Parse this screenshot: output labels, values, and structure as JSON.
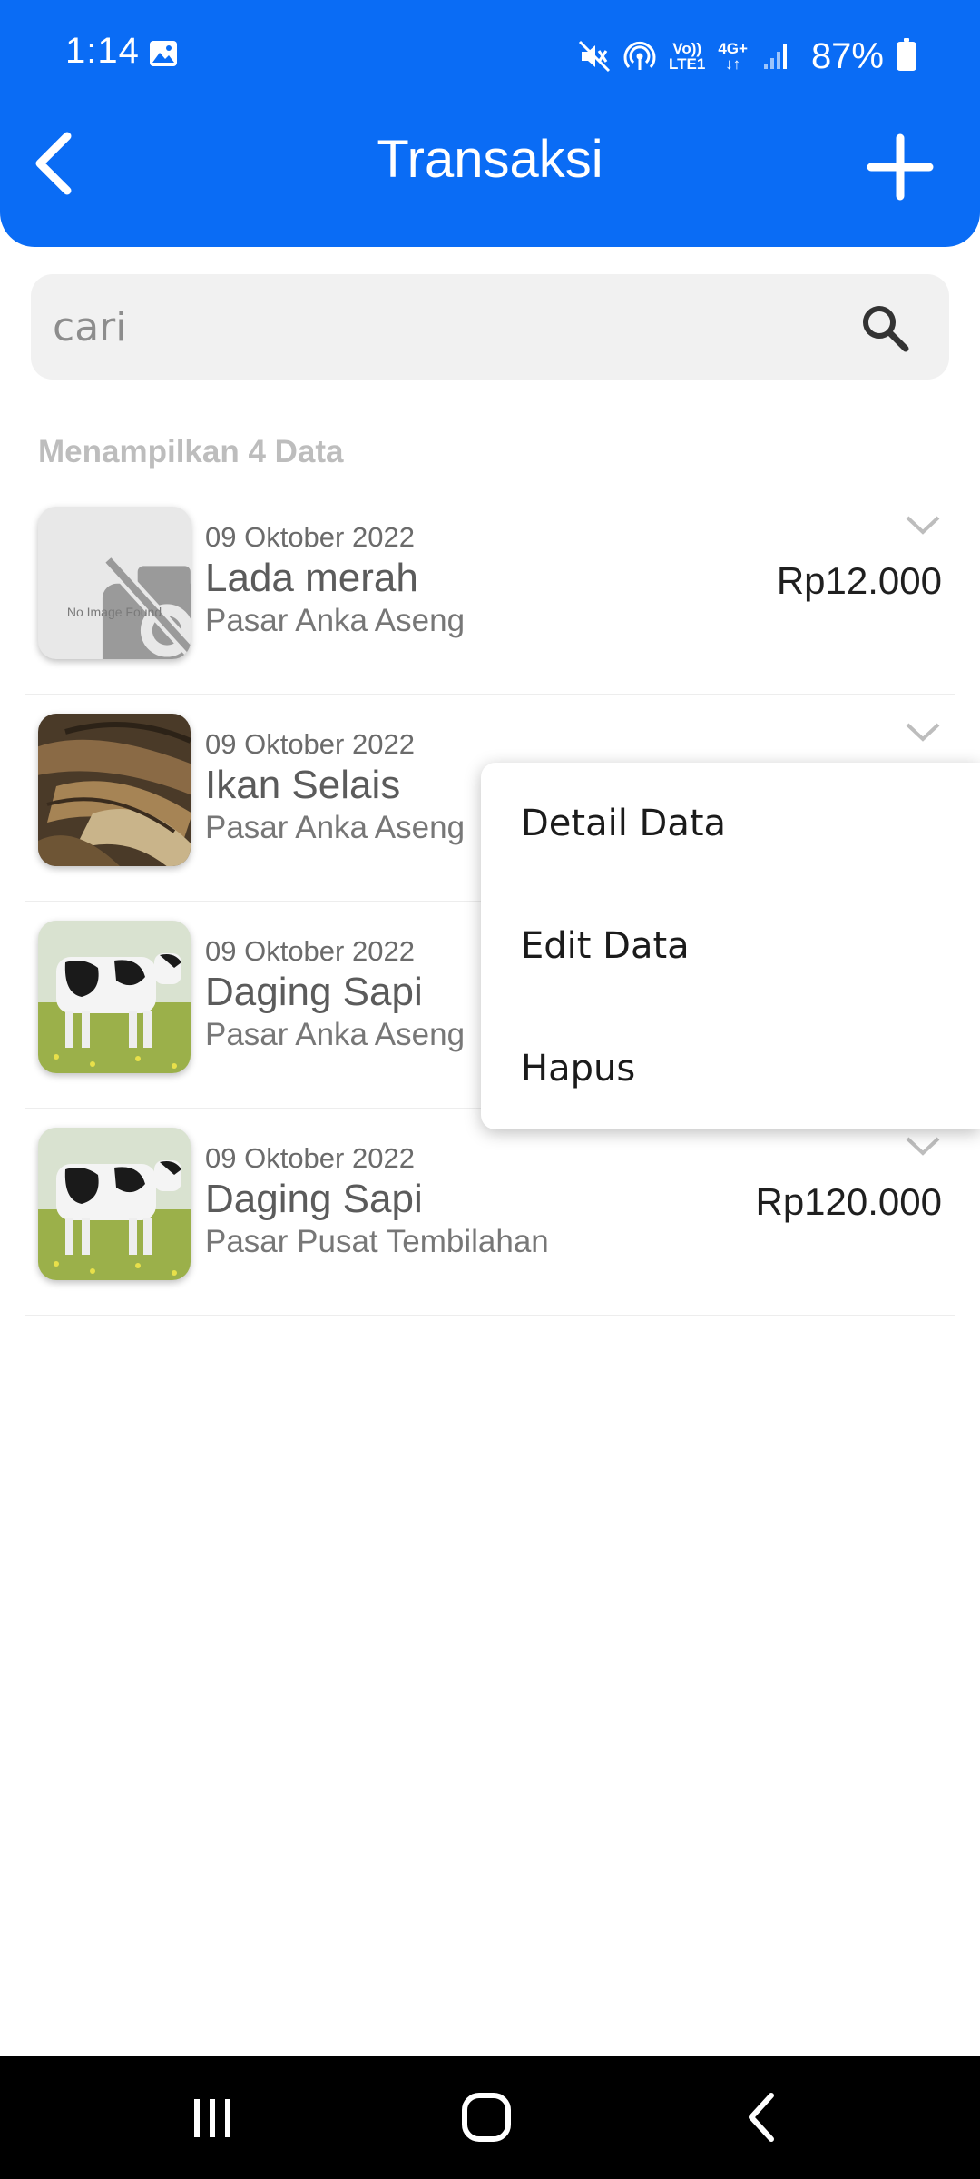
{
  "status_bar": {
    "time": "1:14",
    "volte_top": "Vo))",
    "volte_bottom": "LTE1",
    "network": "4G+",
    "battery": "87%"
  },
  "header": {
    "title": "Transaksi",
    "background_color": "#0a6cf5"
  },
  "search": {
    "placeholder": "cari"
  },
  "list": {
    "count_label": "Menampilkan 4 Data",
    "items": [
      {
        "date": "09 Oktober 2022",
        "name": "Lada merah",
        "place": "Pasar Anka Aseng",
        "price": "Rp12.000",
        "image": "no-image",
        "no_image_text": "No Image Found"
      },
      {
        "date": "09 Oktober 2022",
        "name": "Ikan Selais",
        "place": "Pasar Anka Aseng",
        "price": "",
        "image": "dried-fish"
      },
      {
        "date": "09 Oktober 2022",
        "name": "Daging Sapi",
        "place": "Pasar Anka Aseng",
        "price": "",
        "image": "cow"
      },
      {
        "date": "09 Oktober 2022",
        "name": "Daging Sapi",
        "place": "Pasar Pusat Tembilahan",
        "price": "Rp120.000",
        "image": "cow"
      }
    ]
  },
  "context_menu": {
    "items": [
      "Detail Data",
      "Edit Data",
      "Hapus"
    ]
  }
}
